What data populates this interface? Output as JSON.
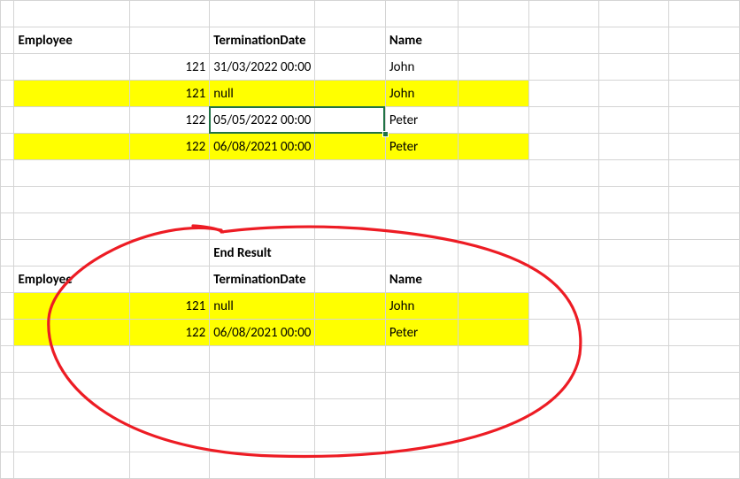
{
  "table1": {
    "header": {
      "employee": "Employee",
      "termDate": "TerminationDate",
      "name": "Name"
    },
    "rows": [
      {
        "employee": "121",
        "termDate": "31/03/2022 00:00",
        "name": "John",
        "highlight": false
      },
      {
        "employee": "121",
        "termDate": "null",
        "name": "John",
        "highlight": true
      },
      {
        "employee": "122",
        "termDate": "05/05/2022 00:00",
        "name": "Peter",
        "highlight": false
      },
      {
        "employee": "122",
        "termDate": "06/08/2021 00:00",
        "name": "Peter",
        "highlight": true
      }
    ]
  },
  "resultTitle": "End Result",
  "table2": {
    "header": {
      "employee": "Employee",
      "termDate": "TerminationDate",
      "name": "Name"
    },
    "rows": [
      {
        "employee": "121",
        "termDate": "null",
        "name": "John",
        "highlight": true
      },
      {
        "employee": "122",
        "termDate": "06/08/2021 00:00",
        "name": "Peter",
        "highlight": true
      }
    ]
  },
  "activeCell": {
    "row": 5,
    "colStart": 3,
    "colSpan": 2
  }
}
